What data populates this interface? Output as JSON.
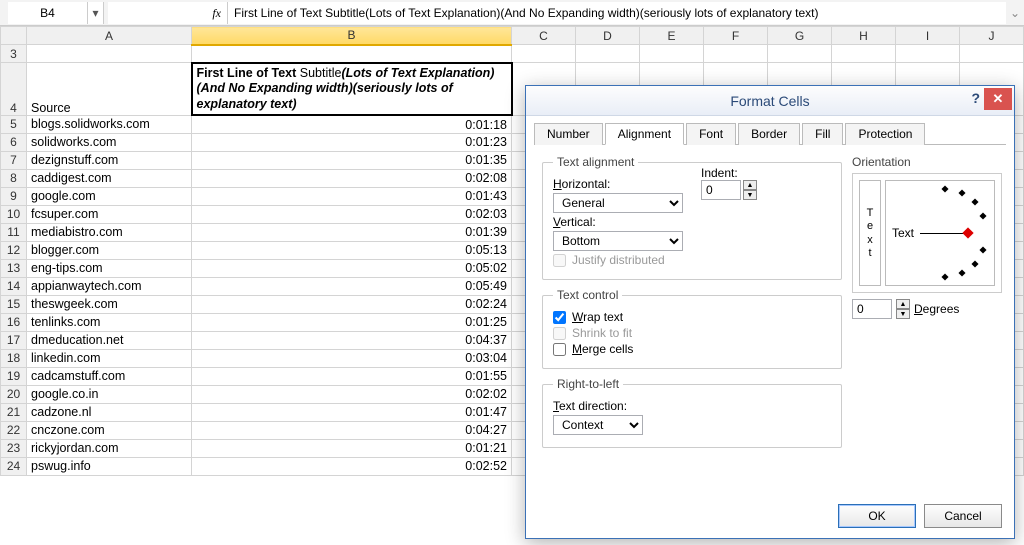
{
  "formula_bar": {
    "name_box": "B4",
    "fx_label": "fx",
    "content": "First Line of Text Subtitle(Lots of Text Explanation)(And No Expanding width)(seriously lots of explanatory text)"
  },
  "columns": [
    "A",
    "B",
    "C",
    "D",
    "E",
    "F",
    "G",
    "H",
    "I",
    "J"
  ],
  "b4": {
    "part1": "First Line of Text",
    "part2": " Subtitle",
    "part3": "(Lots of Text Explanation)(And No Expanding width)(seriously lots of explanatory text)"
  },
  "a4_header": "Source",
  "rows": [
    {
      "n": 3,
      "a": "",
      "b": ""
    },
    {
      "n": 4,
      "a": "Source",
      "b": "__B4__"
    },
    {
      "n": 5,
      "a": "blogs.solidworks.com",
      "b": "0:01:18"
    },
    {
      "n": 6,
      "a": "solidworks.com",
      "b": "0:01:23"
    },
    {
      "n": 7,
      "a": "dezignstuff.com",
      "b": "0:01:35"
    },
    {
      "n": 8,
      "a": "caddigest.com",
      "b": "0:02:08"
    },
    {
      "n": 9,
      "a": "google.com",
      "b": "0:01:43"
    },
    {
      "n": 10,
      "a": "fcsuper.com",
      "b": "0:02:03"
    },
    {
      "n": 11,
      "a": "mediabistro.com",
      "b": "0:01:39"
    },
    {
      "n": 12,
      "a": "blogger.com",
      "b": "0:05:13"
    },
    {
      "n": 13,
      "a": "eng-tips.com",
      "b": "0:05:02"
    },
    {
      "n": 14,
      "a": "appianwaytech.com",
      "b": "0:05:49"
    },
    {
      "n": 15,
      "a": "theswgeek.com",
      "b": "0:02:24"
    },
    {
      "n": 16,
      "a": "tenlinks.com",
      "b": "0:01:25"
    },
    {
      "n": 17,
      "a": "dmeducation.net",
      "b": "0:04:37"
    },
    {
      "n": 18,
      "a": "linkedin.com",
      "b": "0:03:04"
    },
    {
      "n": 19,
      "a": "cadcamstuff.com",
      "b": "0:01:55"
    },
    {
      "n": 20,
      "a": "google.co.in",
      "b": "0:02:02"
    },
    {
      "n": 21,
      "a": "cadzone.nl",
      "b": "0:01:47"
    },
    {
      "n": 22,
      "a": "cnczone.com",
      "b": "0:04:27"
    },
    {
      "n": 23,
      "a": "rickyjordan.com",
      "b": "0:01:21"
    },
    {
      "n": 24,
      "a": "pswug.info",
      "b": "0:02:52"
    }
  ],
  "dialog": {
    "title": "Format Cells",
    "tabs": [
      "Number",
      "Alignment",
      "Font",
      "Border",
      "Fill",
      "Protection"
    ],
    "active_tab": 1,
    "groups": {
      "text_alignment": "Text alignment",
      "horizontal": "Horizontal:",
      "horizontal_value": "General",
      "vertical": "Vertical:",
      "vertical_value": "Bottom",
      "indent": "Indent:",
      "indent_value": "0",
      "justify": "Justify distributed",
      "text_control": "Text control",
      "wrap": "Wrap text",
      "shrink": "Shrink to fit",
      "merge": "Merge cells",
      "rtl": "Right-to-left",
      "text_direction": "Text direction:",
      "text_direction_value": "Context",
      "orientation": "Orientation",
      "orient_text": "Text",
      "orient_v_t": "T",
      "orient_v_e": "e",
      "orient_v_x": "x",
      "orient_v_t2": "t",
      "degrees_value": "0",
      "degrees_label": "Degrees"
    },
    "buttons": {
      "ok": "OK",
      "cancel": "Cancel"
    }
  }
}
